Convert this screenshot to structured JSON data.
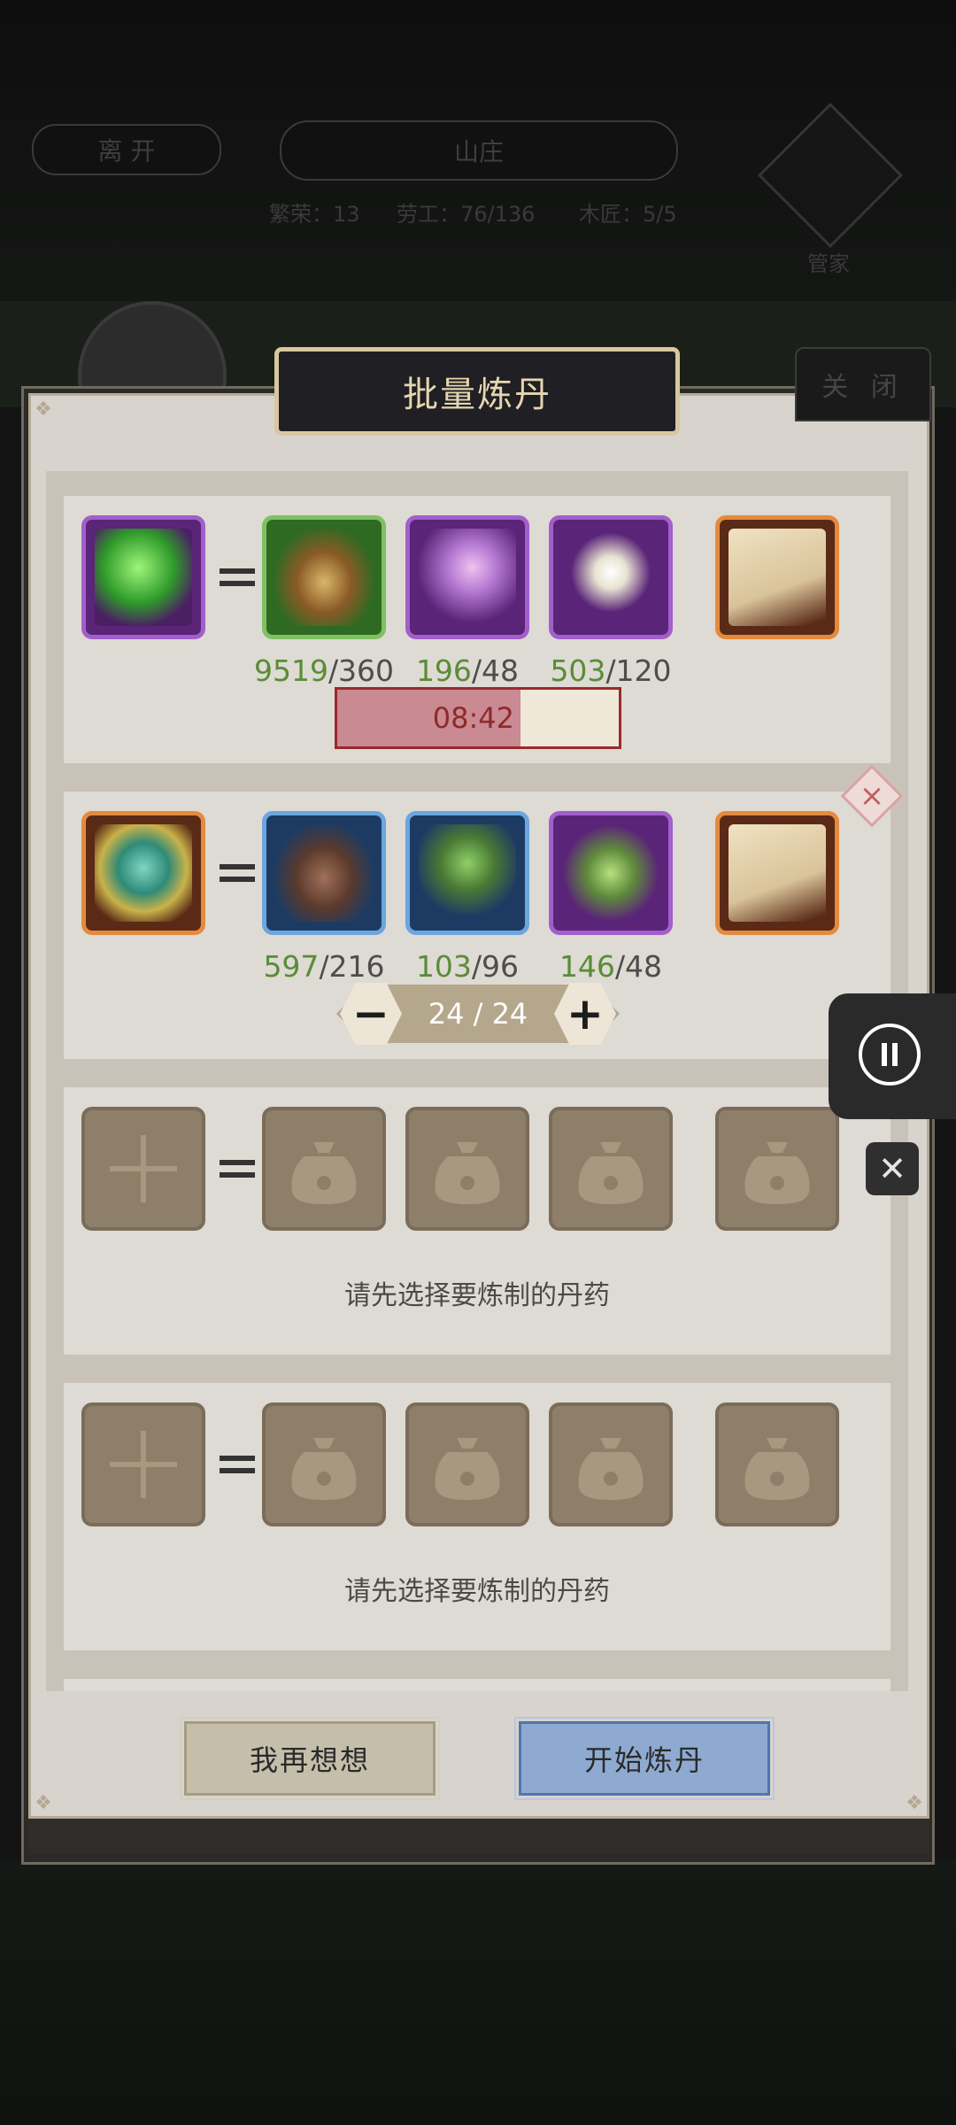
{
  "background": {
    "leave_label": "离 开",
    "villa_title": "山庄",
    "stats": [
      "繁荣：13",
      "劳工：76/136",
      "木匠：5/5"
    ],
    "steward_label": "管家"
  },
  "dialog": {
    "title": "批量炼丹",
    "close_label": "关 闭",
    "recipes": [
      {
        "output_icon": "green-orb-pill-icon",
        "ingredients": [
          {
            "icon": "bark-herb-icon",
            "have": "9519",
            "need": "/360"
          },
          {
            "icon": "purple-lily-icon",
            "have": "196",
            "need": "/48"
          },
          {
            "icon": "white-flower-icon",
            "have": "503",
            "need": "/120"
          }
        ],
        "recipe_icon": "scroll-recipe-icon",
        "timer": "08:42",
        "progress": 0.65
      },
      {
        "output_icon": "jade-swirl-pill-icon",
        "ingredients": [
          {
            "icon": "seed-pods-icon",
            "have": "597",
            "need": "/216"
          },
          {
            "icon": "ginseng-root-icon",
            "have": "103",
            "need": "/96"
          },
          {
            "icon": "green-leaf-herb-icon",
            "have": "146",
            "need": "/48"
          }
        ],
        "recipe_icon": "scroll-recipe-icon",
        "quantity": "24 / 24"
      },
      {
        "hint": "请先选择要炼制的丹药"
      },
      {
        "hint": "请先选择要炼制的丹药"
      }
    ],
    "cancel_label": "我再想想",
    "start_label": "开始炼丹"
  }
}
